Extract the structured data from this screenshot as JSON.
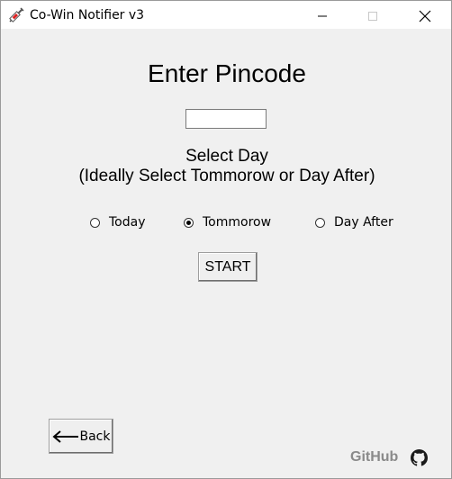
{
  "window": {
    "title": "Co-Win Notifier v3",
    "icon": "syringe-icon",
    "controls": [
      "minimize-icon",
      "maximize-icon",
      "close-icon"
    ]
  },
  "main": {
    "heading": "Enter Pincode",
    "pincode_value": "",
    "select_day": "Select Day",
    "hint": "(Ideally Select Tommorow or Day After)",
    "options": [
      {
        "label": "Today",
        "selected": false
      },
      {
        "label": "Tommorow",
        "selected": true
      },
      {
        "label": "Day After",
        "selected": false
      }
    ],
    "start_label": "START"
  },
  "footer": {
    "back_label": "Back",
    "back_icon": "arrow-left-icon",
    "github_label": "GitHub",
    "github_icon": "github-icon"
  },
  "colors": {
    "background": "#f0f0f0",
    "titlebar": "#ffffff",
    "github_text": "#8a8a8a"
  }
}
